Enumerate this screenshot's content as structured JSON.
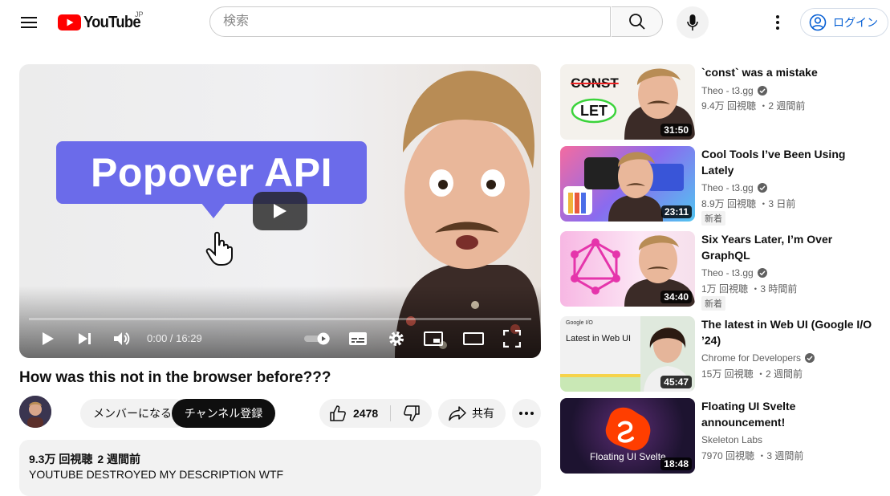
{
  "masthead": {
    "logo_text": "YouTube",
    "region": "JP",
    "search_placeholder": "検索",
    "login_label": "ログイン"
  },
  "player": {
    "thumbnail_text": "Popover API",
    "time": "0:00 / 16:29",
    "progress": 0
  },
  "video": {
    "title": "How was this not in the browser before???",
    "member_label": "メンバーになる",
    "subscribe_label": "チャンネル登録",
    "likes": "2478",
    "share_label": "共有",
    "views": "9.3万 回視聴",
    "posted": "2 週間前",
    "description": "YOUTUBE DESTROYED MY DESCRIPTION WTF"
  },
  "related": [
    {
      "title": "`const` was a mistake",
      "channel": "Theo - t3.gg",
      "verified": true,
      "stats": "9.4万 回視聴 ・2 週間前",
      "duration": "31:50",
      "badge": "",
      "thumb_text": [
        "CONST",
        "LET"
      ]
    },
    {
      "title": "Cool Tools I’ve Been Using Lately",
      "channel": "Theo - t3.gg",
      "verified": true,
      "stats": "8.9万 回視聴 ・3 日前",
      "duration": "23:11",
      "badge": "新着"
    },
    {
      "title": "Six Years Later, I’m Over GraphQL",
      "channel": "Theo - t3.gg",
      "verified": true,
      "stats": "1万 回視聴 ・3 時間前",
      "duration": "34:40",
      "badge": "新着"
    },
    {
      "title": "The latest in Web UI (Google I/O ’24)",
      "channel": "Chrome for Developers",
      "verified": true,
      "stats": "15万 回視聴 ・2 週間前",
      "duration": "45:47",
      "badge": "",
      "thumb_text": [
        "Google I/O",
        "Latest in Web UI"
      ]
    },
    {
      "title": "Floating UI Svelte announcement!",
      "channel": "Skeleton Labs",
      "verified": false,
      "stats": "7970 回視聴 ・3 週間前",
      "duration": "18:48",
      "badge": "",
      "thumb_text": [
        "Floating UI Svelte"
      ]
    }
  ],
  "colors": {
    "brand_red": "#ff0000",
    "link_blue": "#065fd4",
    "bubble_purple": "#6b6bea"
  }
}
